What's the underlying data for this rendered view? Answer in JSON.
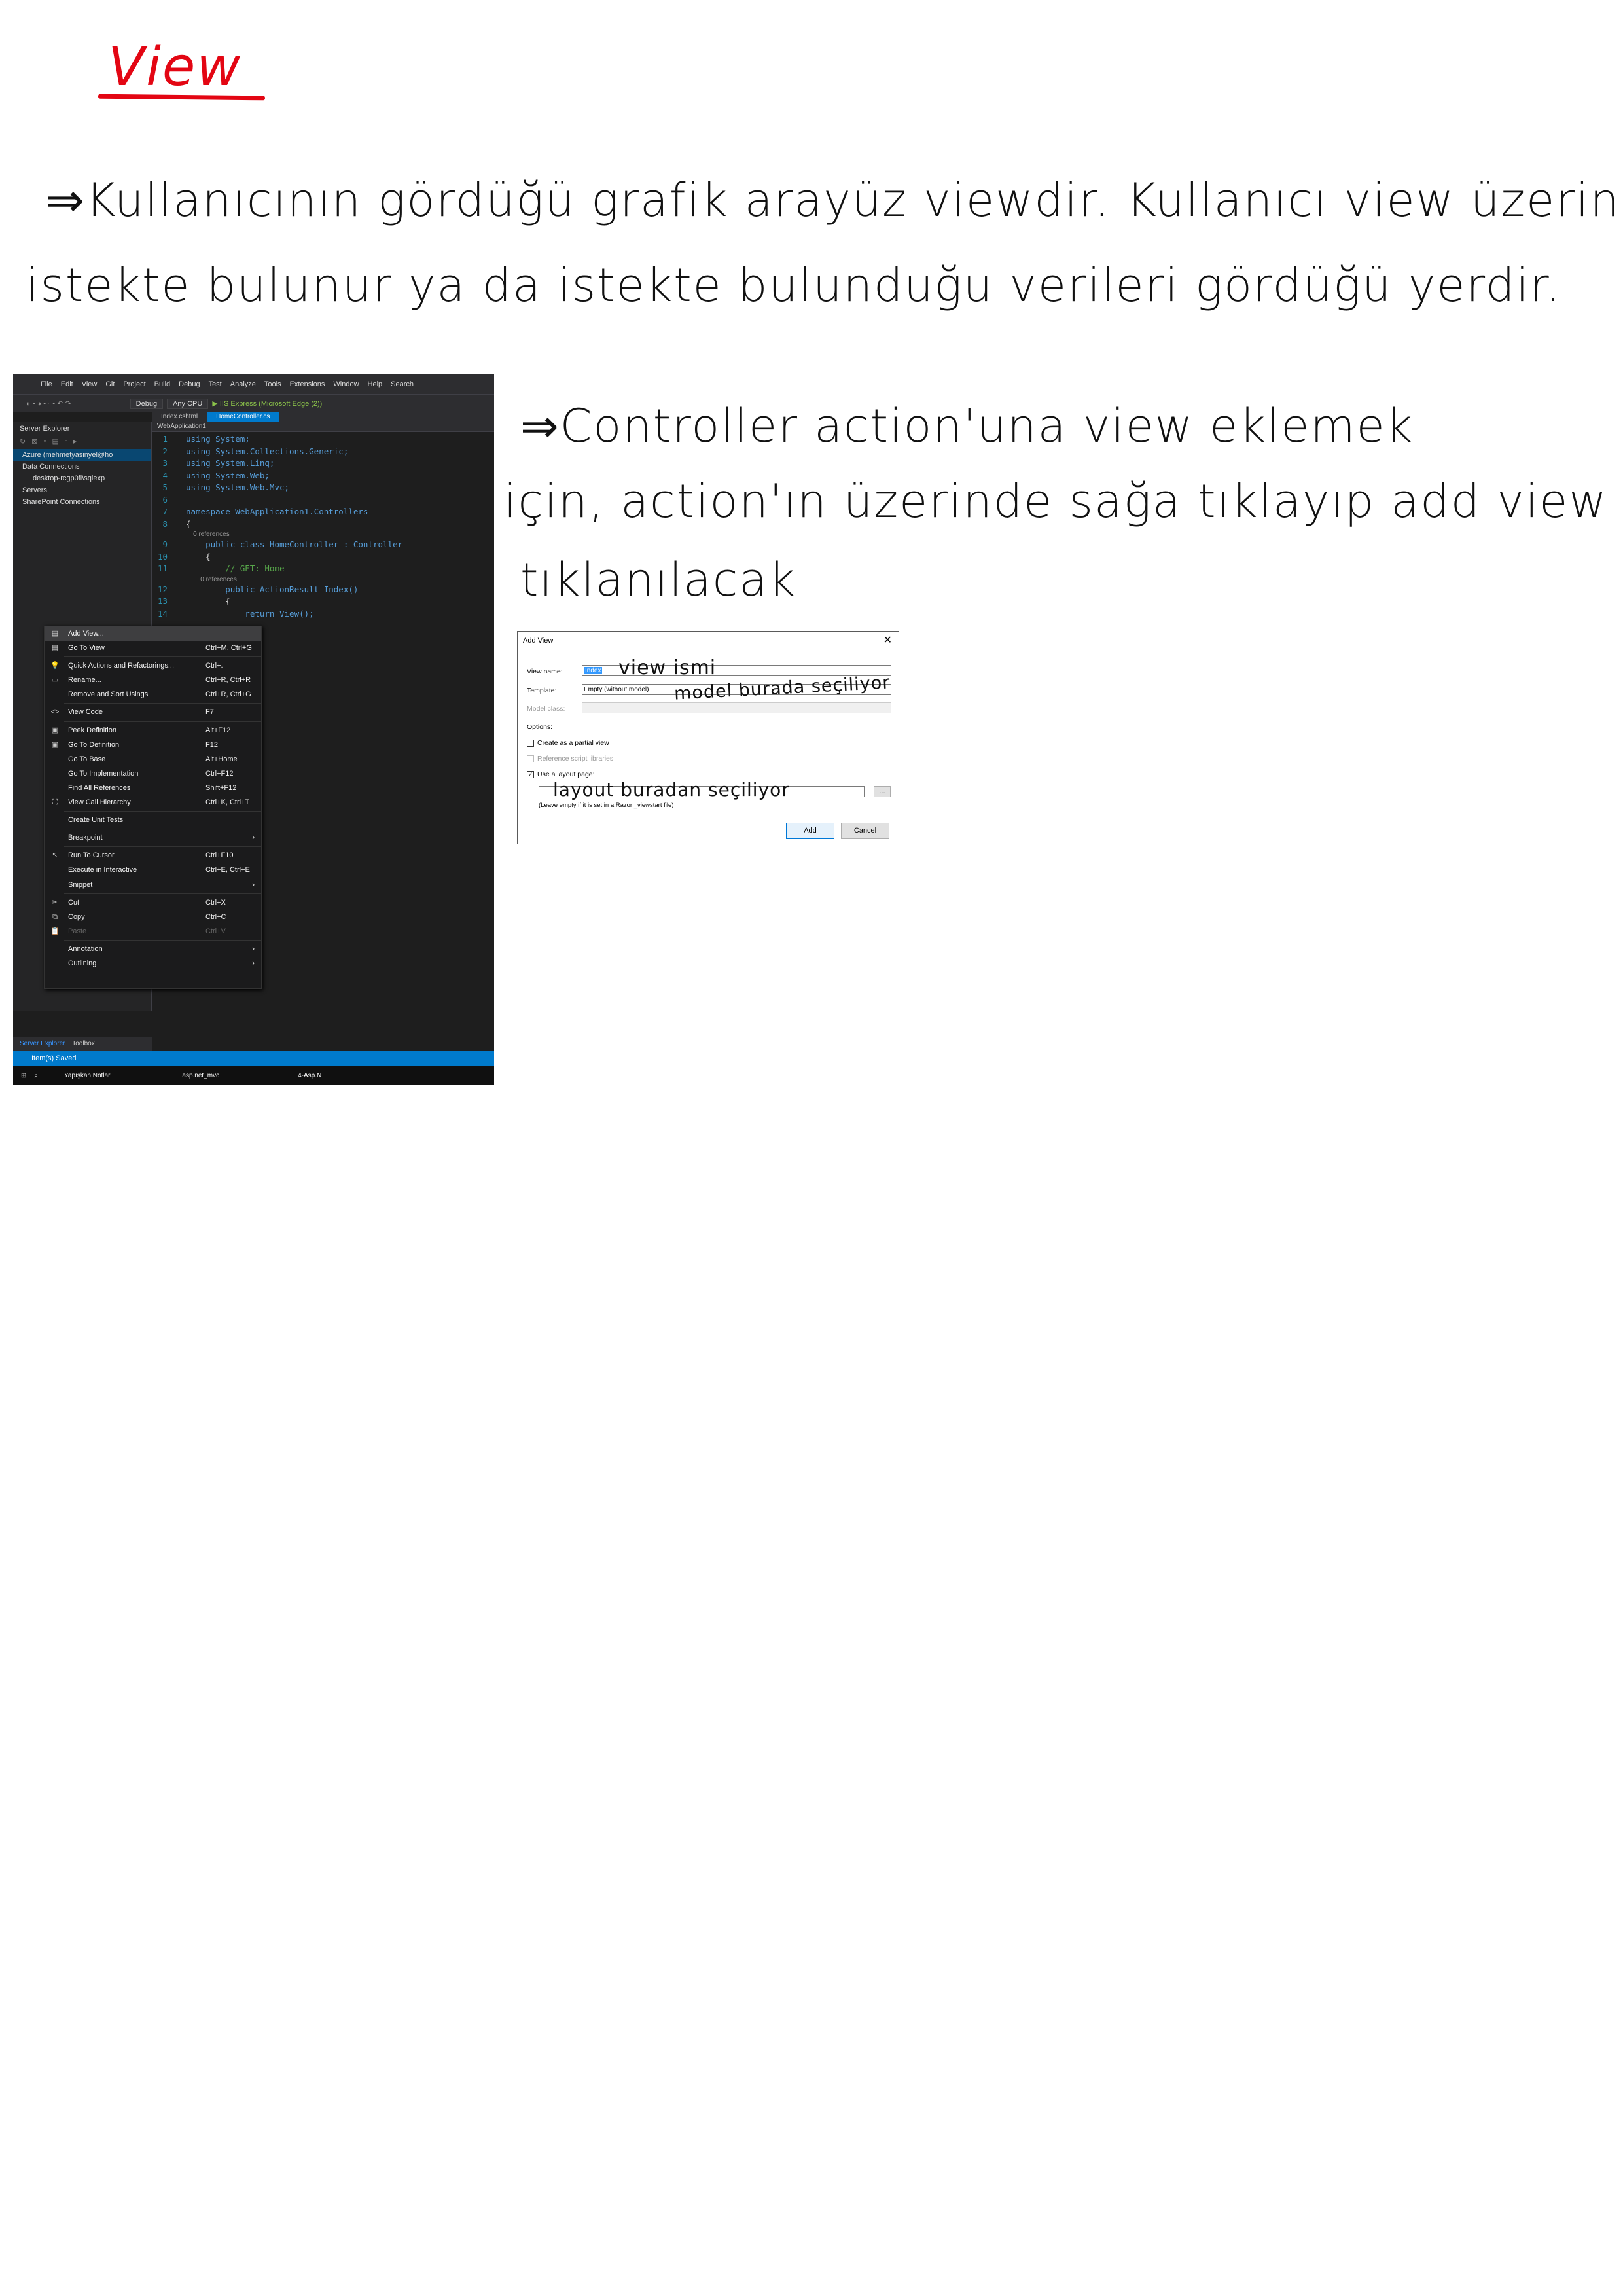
{
  "notes": {
    "title": "View",
    "line1": "⇒Kullanıcının   gördüğü   grafik   arayüz   viewdir. Kullanıcı   view   üzerinde",
    "line2": "istekte   bulunur   ya da   istekte   bulunduğu   verileri   gördüğü yerdir.",
    "line3": "⇒Controller   action'una   view   eklemek",
    "line4": "için, action'ın   üzerinde   sağa   tıklayıp   add view",
    "line5": "tıklanılacak"
  },
  "vs": {
    "menu": [
      "File",
      "Edit",
      "View",
      "Git",
      "Project",
      "Build",
      "Debug",
      "Test",
      "Analyze",
      "Tools",
      "Extensions",
      "Window",
      "Help",
      "Search"
    ],
    "toolbar": {
      "config": "Debug",
      "platform": "Any CPU",
      "run": "▶ IIS Express (Microsoft Edge (2))"
    },
    "server_explorer": {
      "title": "Server Explorer",
      "items": [
        "Azure (mehmetyasinyel@ho",
        "Data Connections",
        "desktop-rcgp0fl\\sqlexp",
        "Servers",
        "SharePoint Connections"
      ]
    },
    "tabs": [
      "Index.cshtml",
      "HomeController.cs"
    ],
    "nav": "WebApplication1",
    "code": [
      {
        "n": "1",
        "t": "using System;"
      },
      {
        "n": "2",
        "t": "using System.Collections.Generic;"
      },
      {
        "n": "3",
        "t": "using System.Linq;"
      },
      {
        "n": "4",
        "t": "using System.Web;"
      },
      {
        "n": "5",
        "t": "using System.Web.Mvc;"
      },
      {
        "n": "6",
        "t": ""
      },
      {
        "n": "7",
        "t": "namespace WebApplication1.Controllers"
      },
      {
        "n": "8",
        "t": "{"
      },
      {
        "n": "",
        "t": "    0 references"
      },
      {
        "n": "9",
        "t": "    public class HomeController : Controller"
      },
      {
        "n": "10",
        "t": "    {"
      },
      {
        "n": "11",
        "t": "        // GET: Home"
      },
      {
        "n": "",
        "t": "        0 references"
      },
      {
        "n": "12",
        "t": "        public ActionResult Index()"
      },
      {
        "n": "13",
        "t": "        {"
      },
      {
        "n": "14",
        "t": "            return View();"
      }
    ],
    "context_menu": [
      {
        "label": "Add View...",
        "sc": "",
        "ico": "▤"
      },
      {
        "label": "Go To View",
        "sc": "Ctrl+M, Ctrl+G",
        "ico": "▤"
      },
      {
        "label": "Quick Actions and Refactorings...",
        "sc": "Ctrl+.",
        "ico": "💡"
      },
      {
        "label": "Rename...",
        "sc": "Ctrl+R, Ctrl+R",
        "ico": "▭"
      },
      {
        "label": "Remove and Sort Usings",
        "sc": "Ctrl+R, Ctrl+G",
        "ico": ""
      },
      {
        "label": "View Code",
        "sc": "F7",
        "ico": "<>"
      },
      {
        "label": "Peek Definition",
        "sc": "Alt+F12",
        "ico": "▣"
      },
      {
        "label": "Go To Definition",
        "sc": "F12",
        "ico": "▣"
      },
      {
        "label": "Go To Base",
        "sc": "Alt+Home",
        "ico": ""
      },
      {
        "label": "Go To Implementation",
        "sc": "Ctrl+F12",
        "ico": ""
      },
      {
        "label": "Find All References",
        "sc": "Shift+F12",
        "ico": ""
      },
      {
        "label": "View Call Hierarchy",
        "sc": "Ctrl+K, Ctrl+T",
        "ico": "⛶"
      },
      {
        "label": "Create Unit Tests",
        "sc": "",
        "ico": ""
      },
      {
        "label": "Breakpoint",
        "sc": "",
        "ico": "",
        "arrow": true
      },
      {
        "label": "Run To Cursor",
        "sc": "Ctrl+F10",
        "ico": "↖"
      },
      {
        "label": "Execute in Interactive",
        "sc": "Ctrl+E, Ctrl+E",
        "ico": ""
      },
      {
        "label": "Snippet",
        "sc": "",
        "ico": "",
        "arrow": true
      },
      {
        "label": "Cut",
        "sc": "Ctrl+X",
        "ico": "✂"
      },
      {
        "label": "Copy",
        "sc": "Ctrl+C",
        "ico": "⧉"
      },
      {
        "label": "Paste",
        "sc": "Ctrl+V",
        "ico": "📋",
        "disabled": true
      },
      {
        "label": "Annotation",
        "sc": "",
        "ico": "",
        "arrow": true
      },
      {
        "label": "Outlining",
        "sc": "",
        "ico": "",
        "arrow": true
      }
    ],
    "bottom_tabs": [
      "Server Explorer",
      "Toolbox"
    ],
    "status": "Item(s) Saved",
    "taskbar": [
      "Yapışkan Notlar",
      "asp.net_mvc",
      "4-Asp.N"
    ]
  },
  "dialog": {
    "title": "Add View",
    "view_name_label": "View name:",
    "view_name": "Index",
    "template_label": "Template:",
    "template": "Empty (without model)",
    "model_label": "Model class:",
    "options_label": "Options:",
    "partial": "Create as a partial view",
    "ref_scripts": "Reference script libraries",
    "layout": "Use a layout page:",
    "layout_hint": "(Leave empty if it is set in a Razor _viewstart file)",
    "browse": "...",
    "add": "Add",
    "cancel": "Cancel",
    "ann1": "view  ismi",
    "ann2": "model  burada  seçiliyor",
    "ann3": "layout  buradan seçiliyor"
  }
}
